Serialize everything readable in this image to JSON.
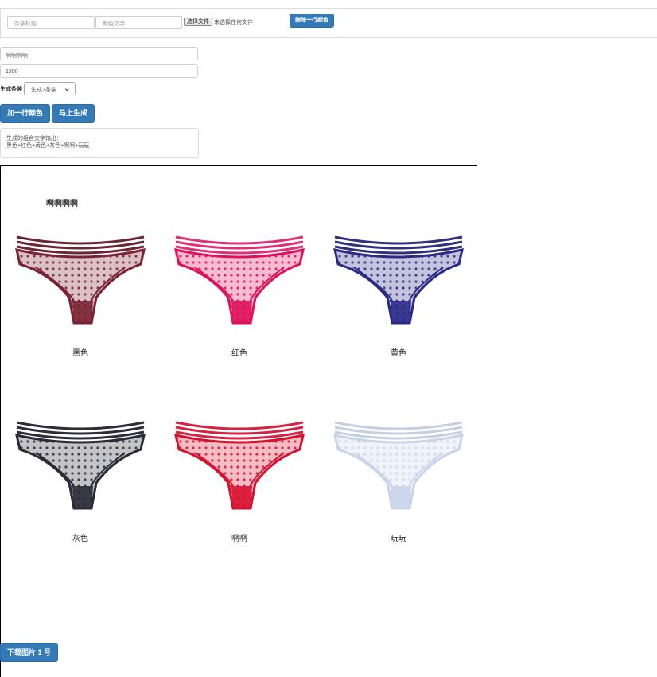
{
  "toolbar": {
    "title_placeholder": "条装标题",
    "color_placeholder": "颜色文字",
    "file_button": "选择文件",
    "file_status": "未选择任何文件",
    "delete_row": "删除一行颜色"
  },
  "form": {
    "title_value": "啊啊啊啊",
    "width_value": "1200",
    "count_label": "生成条装",
    "count_selected": "生成2条装",
    "add_row": "加一行颜色",
    "generate": "马上生成",
    "output_label": "生成的组合文字输出：",
    "output_text": "黑色+红色+黄色+灰色+啊啊+玩玩"
  },
  "canvas": {
    "title": "啊啊啊啊",
    "products": [
      {
        "label": "黑色",
        "color": "#7a2233",
        "band": "#6b2535"
      },
      {
        "label": "红色",
        "color": "#e0105a",
        "band": "#e0307a"
      },
      {
        "label": "黄色",
        "color": "#2a2a86",
        "band": "#30307e"
      },
      {
        "label": "灰色",
        "color": "#2a2a36",
        "band": "#2c2c3a"
      },
      {
        "label": "啊啊",
        "color": "#d8102e",
        "band": "#d82040"
      },
      {
        "label": "玩玩",
        "color": "#c9d4ea",
        "band": "#c4cfe6"
      }
    ]
  },
  "download": "下载图片 1 号"
}
